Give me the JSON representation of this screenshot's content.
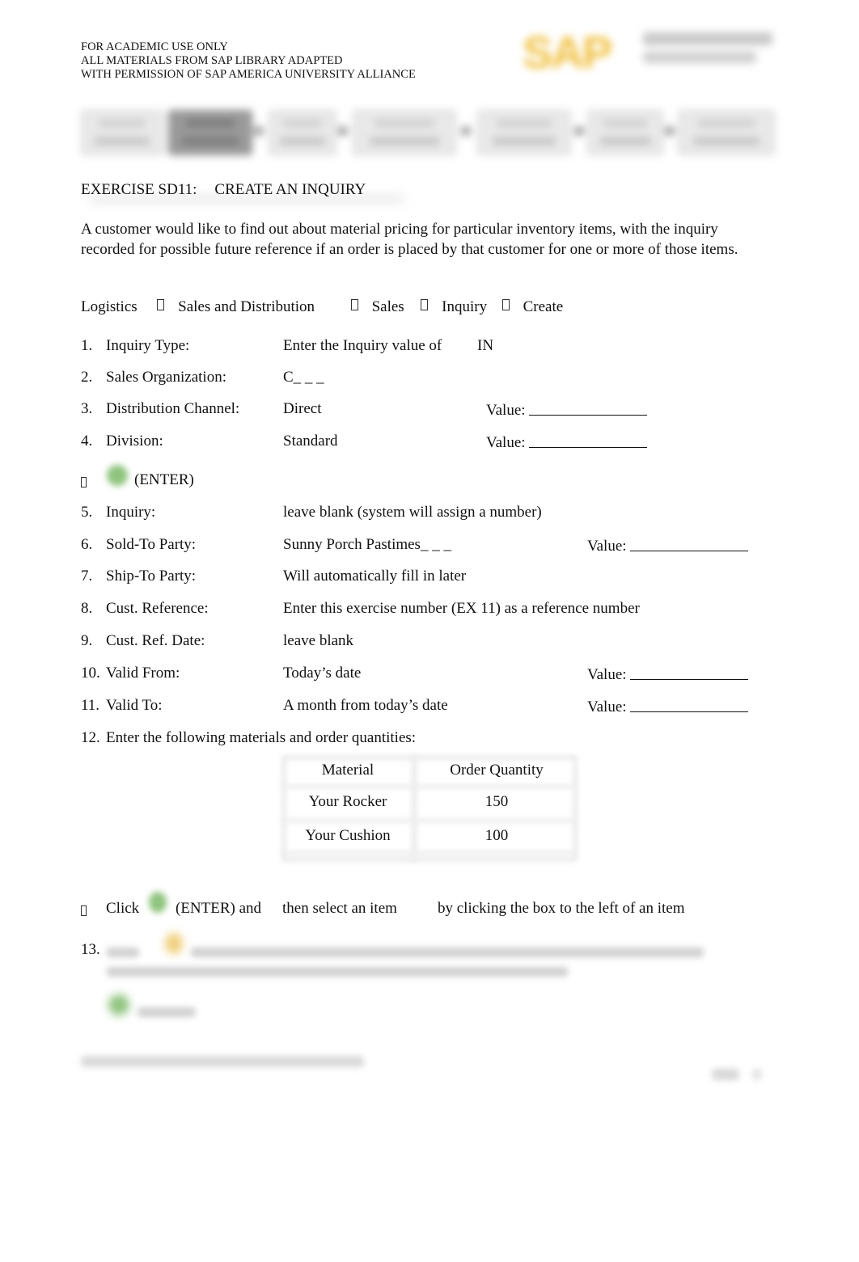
{
  "header": {
    "lines": [
      "FOR ACADEMIC USE ONLY",
      "ALL MATERIALS FROM SAP LIBRARY ADAPTED",
      "WITH PERMISSION OF SAP AMERICA UNIVERSITY ALLIANCE"
    ],
    "logo_text": "SAP"
  },
  "nav": {
    "steps": 7,
    "active_index": 1
  },
  "title": {
    "code": "EXERCISE SD11:",
    "name": "CREATE AN INQUIRY"
  },
  "intro": "A customer would like to find out about material pricing for particular inventory items, with the inquiry recorded for possible future reference if an order is placed by that customer for one or more of those items.",
  "menu_path": [
    "Logistics",
    "Sales and Distribution",
    "Sales",
    "Inquiry",
    "Create"
  ],
  "steps_a": [
    {
      "num": "1.",
      "label": "Inquiry Type:",
      "value": "Enter the Inquiry value of",
      "extra": "IN"
    },
    {
      "num": "2.",
      "label": "Sales Organization:",
      "value": "C_ _ _"
    },
    {
      "num": "3.",
      "label": "Distribution Channel:",
      "value": "Direct",
      "field_label": "Value:"
    },
    {
      "num": "4.",
      "label": "Division:",
      "value": "Standard",
      "field_label": "Value:"
    }
  ],
  "enter_step": {
    "label": "(ENTER)"
  },
  "steps_b": [
    {
      "num": "5.",
      "label": "Inquiry:",
      "value": "leave blank (system will assign a number)"
    },
    {
      "num": "6.",
      "label": "Sold-To Party:",
      "value": "Sunny Porch Pastimes_ _ _",
      "field_label": "Value:"
    },
    {
      "num": "7.",
      "label": "Ship-To Party:",
      "value": "Will automatically fill in later"
    },
    {
      "num": "8.",
      "label": "Cust. Reference:",
      "value": "Enter this exercise number (EX 11) as a reference number"
    },
    {
      "num": "9.",
      "label": "Cust. Ref. Date:",
      "value": "leave blank"
    },
    {
      "num": "10.",
      "label": "Valid From:",
      "value": "Today’s date",
      "field_label": "Value:"
    },
    {
      "num": "11.",
      "label": "Valid To:",
      "value": "A month from today’s date",
      "field_label": "Value:"
    },
    {
      "num": "12.",
      "label": "Enter the following materials and order quantities:"
    }
  ],
  "materials_table": {
    "headers": [
      "Material",
      "Order Quantity"
    ],
    "rows": [
      [
        "Your Rocker",
        "150"
      ],
      [
        "Your Cushion",
        "100"
      ]
    ]
  },
  "click_step": {
    "click": "Click",
    "enter_and": "(ENTER) and",
    "then_select": "then select an item",
    "by_clicking": "by clicking the box to the left of an item"
  },
  "step13": {
    "num": "13."
  }
}
